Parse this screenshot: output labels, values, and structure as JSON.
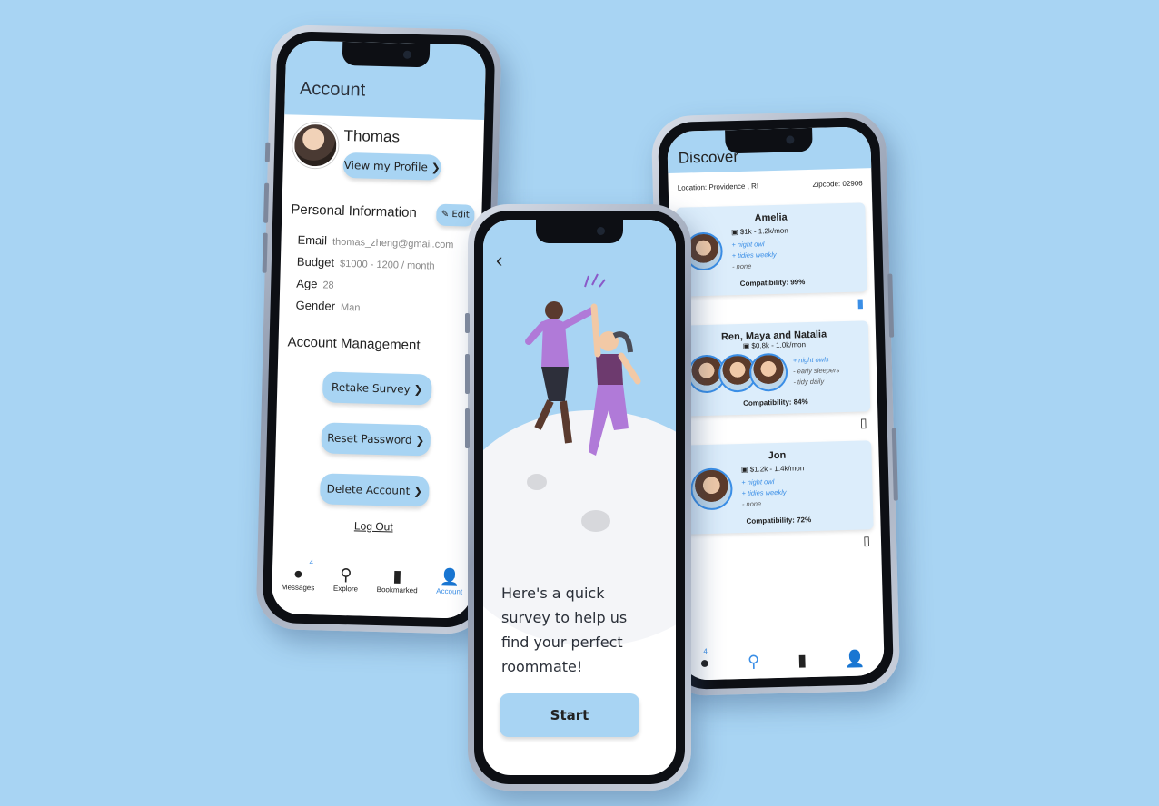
{
  "account": {
    "title": "Account",
    "name": "Thomas",
    "view_profile": "View my Profile ❯",
    "personal_info_title": "Personal Information",
    "edit_label": "✎ Edit",
    "fields": [
      {
        "label": "Email",
        "value": "thomas_zheng@gmail.com"
      },
      {
        "label": "Budget",
        "value": "$1000 - 1200 / month"
      },
      {
        "label": "Age",
        "value": "28"
      },
      {
        "label": "Gender",
        "value": "Man"
      }
    ],
    "management_title": "Account Management",
    "buttons": [
      "Retake Survey ❯",
      "Reset Password ❯",
      "Delete Account ❯"
    ],
    "logout": "Log Out"
  },
  "tabbar": {
    "messages": "Messages",
    "explore": "Explore",
    "bookmarked": "Bookmarked",
    "account": "Account",
    "messages_badge": "4"
  },
  "survey": {
    "text": "Here's a quick survey to help us find your perfect roommate!",
    "start": "Start"
  },
  "discover": {
    "title": "Discover",
    "location": "Location: Providence , RI",
    "zipcode": "Zipcode: 02906",
    "cards": [
      {
        "name": "Amelia",
        "budget": "$1k - 1.2k/mon",
        "traits": [
          "+ night owl",
          "+ tidies weekly",
          "- none"
        ],
        "compat": "Compatibility: 99%",
        "bookmarked": true
      },
      {
        "name": "Ren, Maya and Natalia",
        "budget": "$0.8k - 1.0k/mon",
        "traits": [
          "+ night owls",
          "- early sleepers",
          "- tidy daily"
        ],
        "compat": "Compatibility: 84%",
        "bookmarked": false
      },
      {
        "name": "Jon",
        "budget": "$1.2k - 1.4k/mon",
        "traits": [
          "+ night owl",
          "+ tidies weekly",
          "- none"
        ],
        "compat": "Compatibility: 72%",
        "bookmarked": false
      }
    ]
  },
  "colors": {
    "background": "#a8d4f3",
    "accent": "#3a8ee6",
    "card": "#dcedfb"
  }
}
